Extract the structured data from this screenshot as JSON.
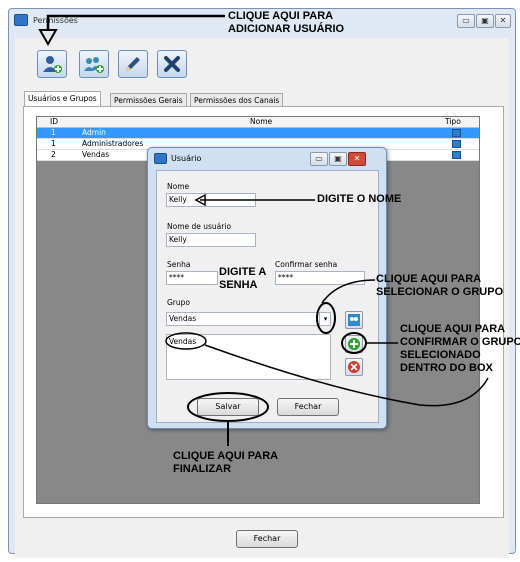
{
  "window": {
    "title": "Permissões",
    "controls": [
      "▭",
      "▣",
      "✕"
    ]
  },
  "toolbar": {
    "buttons": [
      {
        "name": "add-user-button",
        "icon": "add-user-icon"
      },
      {
        "name": "add-group-button",
        "icon": "add-group-icon"
      },
      {
        "name": "edit-button",
        "icon": "pencil-icon"
      },
      {
        "name": "delete-button",
        "icon": "delete-x-icon"
      }
    ]
  },
  "tabs": [
    "Usuários e Grupos",
    "Permissões Gerais",
    "Permissões dos Canais"
  ],
  "grid": {
    "columns": [
      "ID",
      "Nome",
      "Tipo"
    ],
    "rows": [
      {
        "id": "1",
        "nome": "Admin",
        "selected": true
      },
      {
        "id": "1",
        "nome": "Administradores",
        "selected": false
      },
      {
        "id": "2",
        "nome": "Vendas",
        "selected": false
      }
    ]
  },
  "dialog": {
    "title": "Usuário",
    "nome_label": "Nome",
    "nome_value": "Kelly",
    "usuario_label": "Nome de usuário",
    "usuario_value": "Kelly",
    "senha_label": "Senha",
    "senha_value": "****",
    "confirmar_label": "Confirmar senha",
    "confirmar_value": "****",
    "grupo_label": "Grupo",
    "grupo_value": "Vendas",
    "list_items": [
      "Vendas"
    ],
    "save_label": "Salvar",
    "close_label": "Fechar"
  },
  "footer": {
    "close_label": "Fechar"
  },
  "annotations": {
    "add_user": "CLIQUE AQUI PARA\nADICIONAR USUÁRIO",
    "type_name": "DIGITE O NOME",
    "type_password": "DIGITE A\nSENHA",
    "select_group": "CLIQUE AQUI PARA\nSELECIONAR O GRUPO",
    "confirm_group": "CLIQUE AQUI PARA\nCONFIRMAR O GRUPO\nSELECIONADO\nDENTRO DO BOX",
    "finish": "CLIQUE AQUI PARA\nFINALIZAR"
  },
  "colors": {
    "selection": "#3399ff",
    "grid_background": "#888888",
    "dialog_frame": "#cfe0f2"
  }
}
